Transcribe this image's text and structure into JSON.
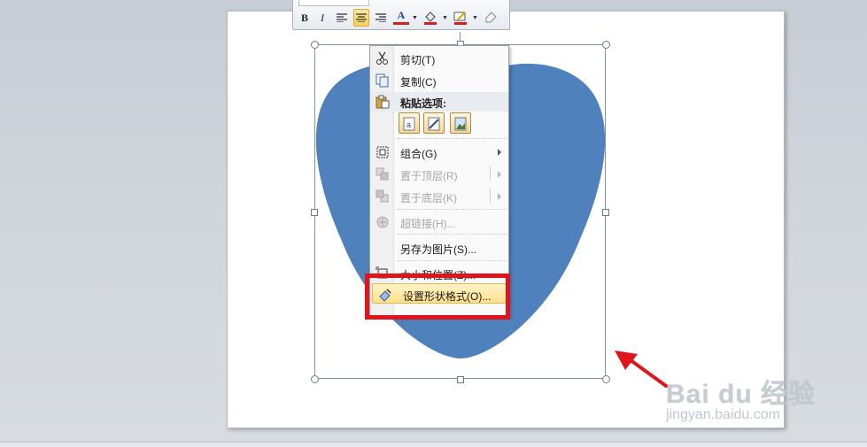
{
  "mini_toolbar": {
    "bold": "B",
    "italic": "I",
    "font_color_letter": "A",
    "icons": [
      "bold-icon",
      "italic-icon",
      "align-left-icon",
      "align-center-icon",
      "align-right-icon",
      "font-color-icon",
      "fill-color-icon",
      "line-color-icon",
      "format-painter-icon"
    ]
  },
  "context_menu": {
    "items": [
      {
        "label": "剪切(T)",
        "icon": "scissors-icon",
        "enabled": true
      },
      {
        "label": "复制(C)",
        "icon": "copy-icon",
        "enabled": true
      },
      {
        "label": "粘贴选项:",
        "icon": "paste-icon",
        "enabled": true,
        "header": true
      },
      {
        "label": "组合(G)",
        "icon": "group-icon",
        "enabled": true,
        "submenu": true
      },
      {
        "label": "置于顶层(R)",
        "icon": "bring-to-front-icon",
        "enabled": false,
        "submenu": true
      },
      {
        "label": "置于底层(K)",
        "icon": "send-to-back-icon",
        "enabled": false,
        "submenu": true
      },
      {
        "label": "超链接(H)...",
        "icon": "hyperlink-icon",
        "enabled": false
      },
      {
        "label": "另存为图片(S)...",
        "icon": "",
        "enabled": true
      },
      {
        "label": "大小和位置(Z)...",
        "icon": "size-position-icon",
        "enabled": true
      },
      {
        "label": "设置形状格式(O)...",
        "icon": "format-shape-icon",
        "enabled": true,
        "highlighted": true
      }
    ],
    "paste_options": [
      "paste-use-destination-theme-icon",
      "paste-keep-source-formatting-icon",
      "paste-picture-icon"
    ]
  },
  "watermark": {
    "logo": "Bai du 经验",
    "url": "jingyan.baidu.com"
  },
  "colors": {
    "shape_fill": "#4f81bd",
    "highlight_box": "#e0141b",
    "arrow": "#e0141b",
    "menu_highlight": "#fde08a"
  }
}
